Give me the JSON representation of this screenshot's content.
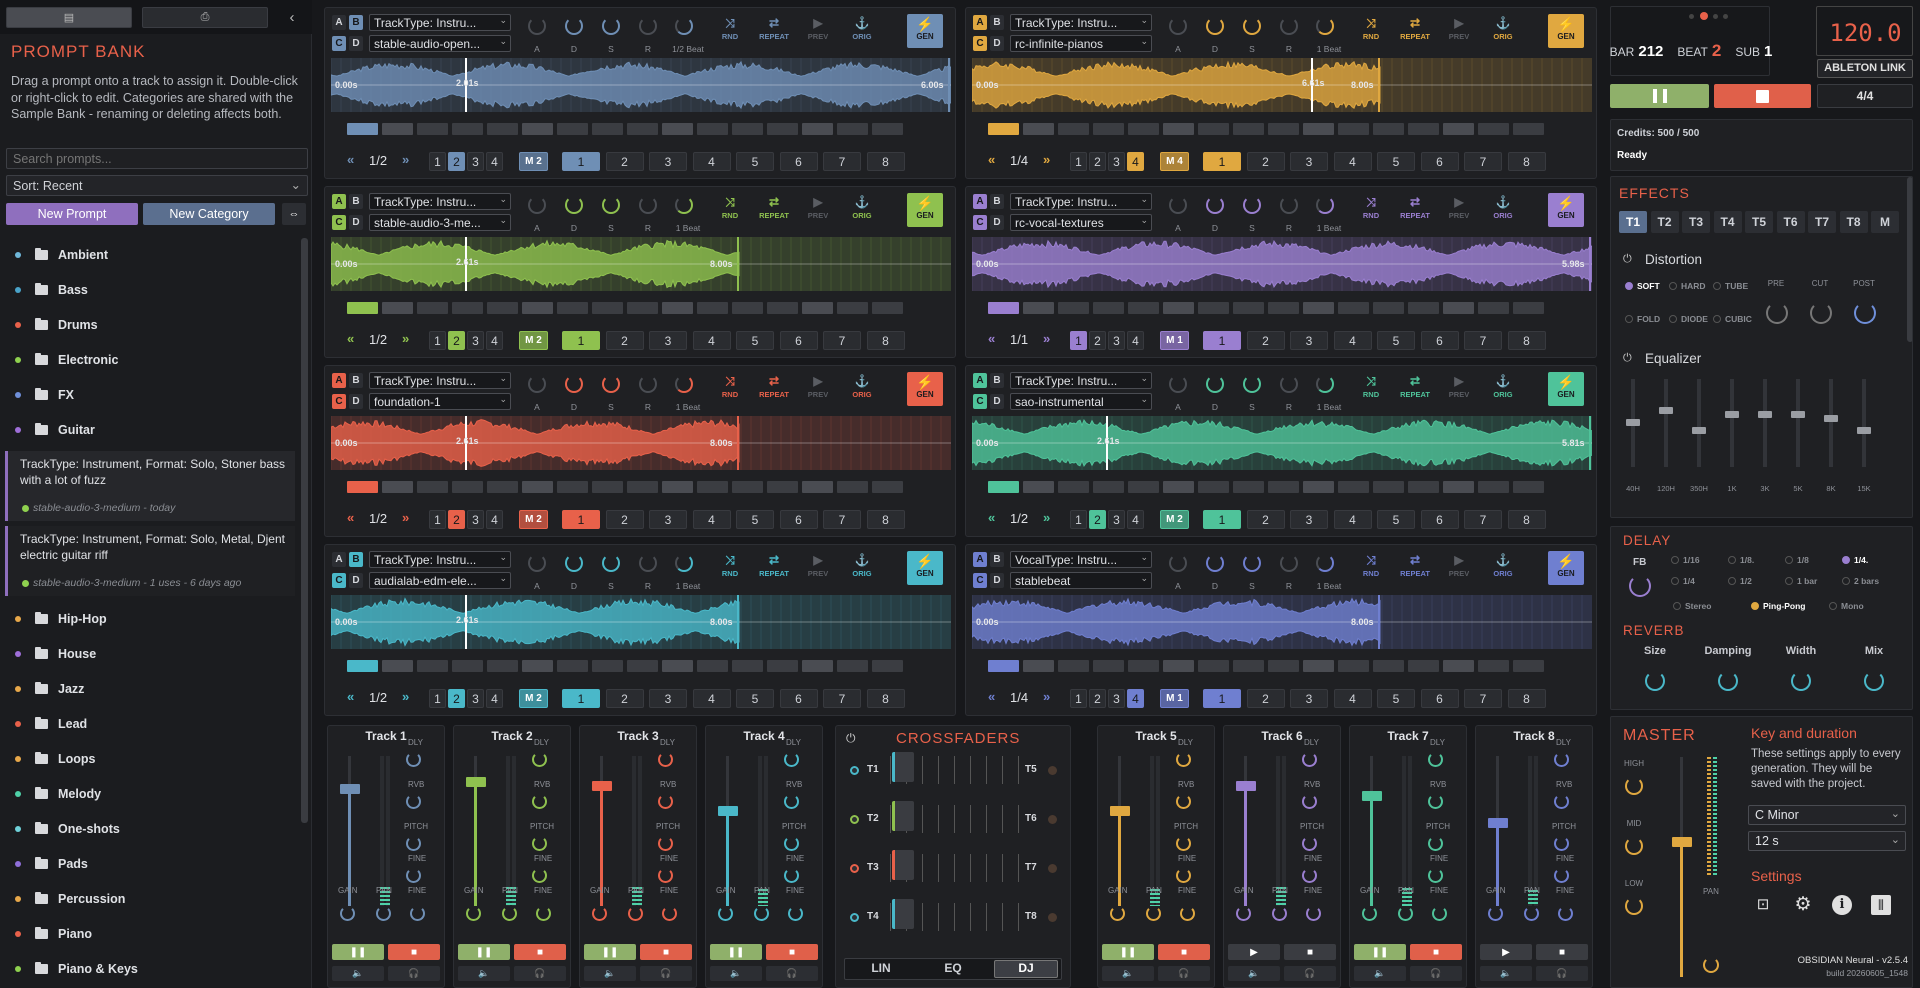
{
  "left": {
    "tab_icons": [
      "chat-icon",
      "sample-icon",
      "collapse-icon"
    ],
    "title": "PROMPT BANK",
    "help": "Drag a prompt onto a track to assign it. Double-click or right-click to edit. Categories are shared with the Sample Bank - renaming or deleting affects both.",
    "search_placeholder": "Search prompts...",
    "sort": "Sort: Recent",
    "new_prompt": "New Prompt",
    "new_category": "New Category",
    "categories_top": [
      {
        "name": "Ambient",
        "color": "#6fb7d9"
      },
      {
        "name": "Bass",
        "color": "#4aa3c9"
      },
      {
        "name": "Drums",
        "color": "#e8614a"
      },
      {
        "name": "Electronic",
        "color": "#8fd14f"
      },
      {
        "name": "FX",
        "color": "#6f8fd9"
      },
      {
        "name": "Guitar",
        "color": "#9f6fd9"
      }
    ],
    "prompts": [
      {
        "text": "TrackType: Instrument, Format: Solo, Stoner bass with a lot of fuzz",
        "meta": "stable-audio-3-medium - today"
      },
      {
        "text": "TrackType: Instrument, Format: Solo, Metal, Djent electric guitar riff",
        "meta": "stable-audio-3-medium - 1 uses - 6 days ago"
      }
    ],
    "categories_bottom": [
      {
        "name": "Hip-Hop",
        "color": "#e8a84a"
      },
      {
        "name": "House",
        "color": "#9f6fd9"
      },
      {
        "name": "Jazz",
        "color": "#e8a84a"
      },
      {
        "name": "Lead",
        "color": "#e8614a"
      },
      {
        "name": "Loops",
        "color": "#e8a84a"
      },
      {
        "name": "Melody",
        "color": "#4fd1a8"
      },
      {
        "name": "One-shots",
        "color": "#6fd1d9"
      },
      {
        "name": "Pads",
        "color": "#8f6fd9"
      },
      {
        "name": "Percussion",
        "color": "#e8a84a"
      },
      {
        "name": "Piano",
        "color": "#e8614a"
      },
      {
        "name": "Piano & Keys",
        "color": "#8fd14f"
      }
    ]
  },
  "tracks": [
    {
      "prompt": "TrackType: Instru...",
      "model": "stable-audio-open...",
      "color": "#6f8fb5",
      "knob_note": "1/2 Beat",
      "start": "0.00s",
      "mid": "2.01s",
      "end": "6.00s",
      "page": "1/2",
      "m": "M 2",
      "bank_active": 2,
      "slot_active": 1,
      "wave_end": 1.0,
      "ab": "B",
      "cd": "C"
    },
    {
      "prompt": "TrackType: Instru...",
      "model": "rc-infinite-pianos",
      "color": "#e0a840",
      "knob_note": "1 Beat",
      "start": "0.00s",
      "mid": "6.61s",
      "end": "8.00s",
      "page": "1/4",
      "m": "M 4",
      "bank_active": 4,
      "slot_active": 1,
      "wave_end": 0.66,
      "ab": "A",
      "cd": "C"
    },
    {
      "prompt": "TrackType: Instru...",
      "model": "stable-audio-3-me...",
      "color": "#8fc14f",
      "knob_note": "1 Beat",
      "start": "0.00s",
      "mid": "2.61s",
      "end": "8.00s",
      "page": "1/2",
      "m": "M 2",
      "bank_active": 2,
      "slot_active": 1,
      "wave_end": 0.66,
      "ab": "A",
      "cd": "C"
    },
    {
      "prompt": "TrackType: Instru...",
      "model": "rc-vocal-textures",
      "color": "#9a7fd0",
      "knob_note": "1 Beat",
      "start": "0.00s",
      "mid": "",
      "end": "5.98s",
      "page": "1/1",
      "m": "M 1",
      "bank_active": 1,
      "slot_active": 1,
      "wave_end": 1.0,
      "ab": "A",
      "cd": "C"
    },
    {
      "prompt": "TrackType: Instru...",
      "model": "foundation-1",
      "color": "#e8614a",
      "knob_note": "1 Beat",
      "start": "0.00s",
      "mid": "2.61s",
      "end": "8.00s",
      "page": "1/2",
      "m": "M 2",
      "bank_active": 2,
      "slot_active": 1,
      "wave_end": 0.66,
      "ab": "A",
      "cd": "C"
    },
    {
      "prompt": "TrackType: Instru...",
      "model": "sao-instrumental",
      "color": "#4fc39a",
      "knob_note": "1 Beat",
      "start": "0.00s",
      "mid": "2.61s",
      "end": "5.81s",
      "page": "1/2",
      "m": "M 2",
      "bank_active": 2,
      "slot_active": 1,
      "wave_end": 1.0,
      "ab": "A",
      "cd": "C"
    },
    {
      "prompt": "TrackType: Instru...",
      "model": "audialab-edm-ele...",
      "color": "#4ab8c9",
      "knob_note": "1 Beat",
      "start": "0.00s",
      "mid": "2.61s",
      "end": "8.00s",
      "page": "1/2",
      "m": "M 2",
      "bank_active": 2,
      "slot_active": 1,
      "wave_end": 0.66,
      "ab": "B",
      "cd": "C"
    },
    {
      "prompt": "VocalType: Instru...",
      "model": "stablebeat",
      "color": "#6f7fd0",
      "knob_note": "1 Beat",
      "start": "0.00s",
      "mid": "",
      "end": "8.00s",
      "page": "1/4",
      "m": "M 1",
      "bank_active": 4,
      "slot_active": 1,
      "wave_end": 0.66,
      "ab": "A",
      "cd": "C"
    }
  ],
  "track_labels": {
    "knobs": [
      "A",
      "D",
      "S",
      "R"
    ],
    "rnd": "RND",
    "repeat": "REPEAT",
    "prev": "PREV",
    "orig": "ORIG",
    "gen": "GEN",
    "banks": [
      "1",
      "2",
      "3",
      "4"
    ],
    "slots": [
      "1",
      "2",
      "3",
      "4",
      "5",
      "6",
      "7",
      "8"
    ],
    "prev_page": "«",
    "next_page": "»",
    "ab_a": "A",
    "ab_b": "B",
    "cd_c": "C",
    "cd_d": "D"
  },
  "mixer": {
    "tracks": [
      "Track 1",
      "Track 2",
      "Track 3",
      "Track 4",
      "Track 5",
      "Track 6",
      "Track 7",
      "Track 8"
    ],
    "colors": [
      "#6f8fb5",
      "#8fc14f",
      "#e8614a",
      "#4ab8c9",
      "#e0a840",
      "#9a7fd0",
      "#4fc39a",
      "#6f7fd0"
    ],
    "fader_levels": [
      0.8,
      0.85,
      0.82,
      0.64,
      0.64,
      0.82,
      0.75,
      0.56
    ],
    "playing": [
      true,
      true,
      true,
      true,
      true,
      false,
      true,
      false
    ],
    "dly": "DLY",
    "rvb": "RVB",
    "pitch": "PITCH",
    "fine": "FINE",
    "gain": "GAIN",
    "pan": "PAN"
  },
  "crossfaders": {
    "title": "CROSSFADERS",
    "left": [
      "T1",
      "T2",
      "T3",
      "T4"
    ],
    "right": [
      "T5",
      "T6",
      "T7",
      "T8"
    ],
    "modes": [
      "LIN",
      "EQ",
      "DJ"
    ],
    "active_mode": "DJ"
  },
  "transport": {
    "bar_label": "BAR",
    "bar": "212",
    "beat_label": "BEAT",
    "beat": "2",
    "sub_label": "SUB",
    "sub": "1",
    "bpm": "120.0",
    "link": "ABLETON LINK",
    "sig": "4/4",
    "credits": "Credits: 500 / 500",
    "status": "Ready"
  },
  "effects": {
    "title": "EFFECTS",
    "tabs": [
      "T1",
      "T2",
      "T3",
      "T4",
      "T5",
      "T6",
      "T7",
      "T8",
      "M"
    ],
    "distortion": "Distortion",
    "dist_modes": [
      "SOFT",
      "HARD",
      "TUBE",
      "FOLD",
      "DIODE",
      "CUBIC"
    ],
    "dist_knobs": [
      "PRE",
      "CUT",
      "POST"
    ],
    "equalizer": "Equalizer",
    "eq_bands": [
      "40H",
      "120H",
      "350H",
      "1K",
      "3K",
      "5K",
      "8K",
      "15K"
    ],
    "eq_levels": [
      0.5,
      0.65,
      0.4,
      0.6,
      0.6,
      0.6,
      0.55,
      0.4
    ]
  },
  "delay": {
    "title": "DELAY",
    "fb": "FB",
    "times": [
      "1/16",
      "1/8.",
      "1/8",
      "1/4.",
      "1/4",
      "1/2",
      "1 bar",
      "2 bars"
    ],
    "active_time": "1/4.",
    "modes": [
      "Stereo",
      "Ping-Pong",
      "Mono"
    ],
    "active_mode": "Ping-Pong"
  },
  "reverb": {
    "title": "REVERB",
    "knobs": [
      "Size",
      "Damping",
      "Width",
      "Mix"
    ]
  },
  "master": {
    "title": "MASTER",
    "eq": [
      "HIGH",
      "MID",
      "LOW"
    ],
    "pan": "PAN",
    "level": 0.6,
    "key_title": "Key and duration",
    "key_help": "These settings apply to every generation. They will be saved with the project.",
    "key": "C Minor",
    "duration": "12 s",
    "settings": "Settings",
    "version": "OBSIDIAN Neural - v2.5.4",
    "build": "build 20260605_1548"
  }
}
